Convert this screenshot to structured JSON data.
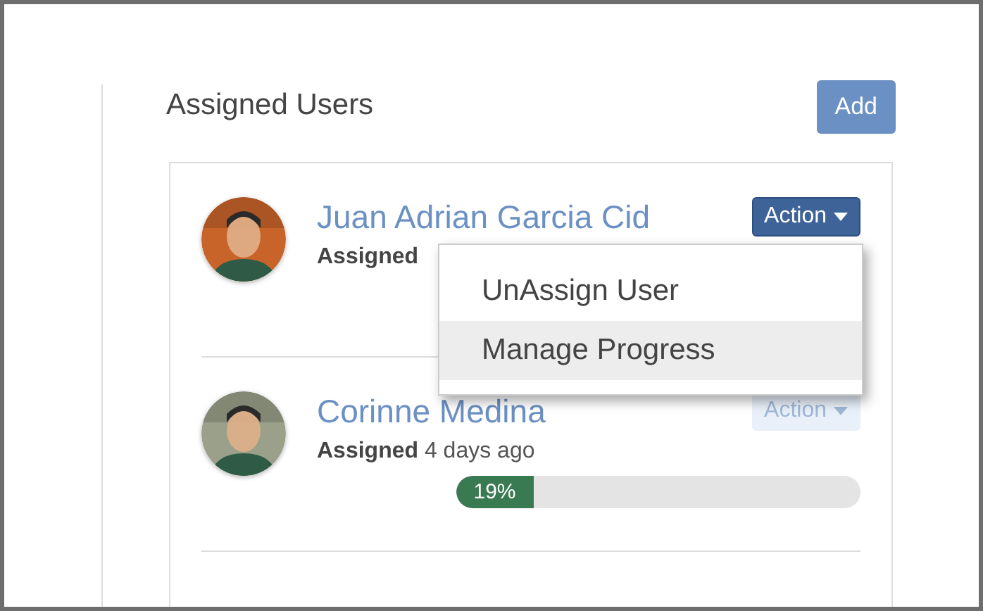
{
  "panel": {
    "title": "Assigned Users",
    "add_button": "Add"
  },
  "users": [
    {
      "name": "Juan Adrian Garcia Cid",
      "assigned_label": "Assigned",
      "action": "Action",
      "disabled": false
    },
    {
      "name": "Corinne Medina",
      "assigned_label": "Assigned",
      "assigned_time": "4 days ago",
      "action": "Action",
      "disabled": true,
      "progress": {
        "level": 0.19,
        "label": "19%"
      }
    }
  ],
  "dropdown": {
    "items": [
      {
        "label": "UnAssign User",
        "selected": false
      },
      {
        "label": "Manage Progress",
        "selected": true
      }
    ]
  }
}
